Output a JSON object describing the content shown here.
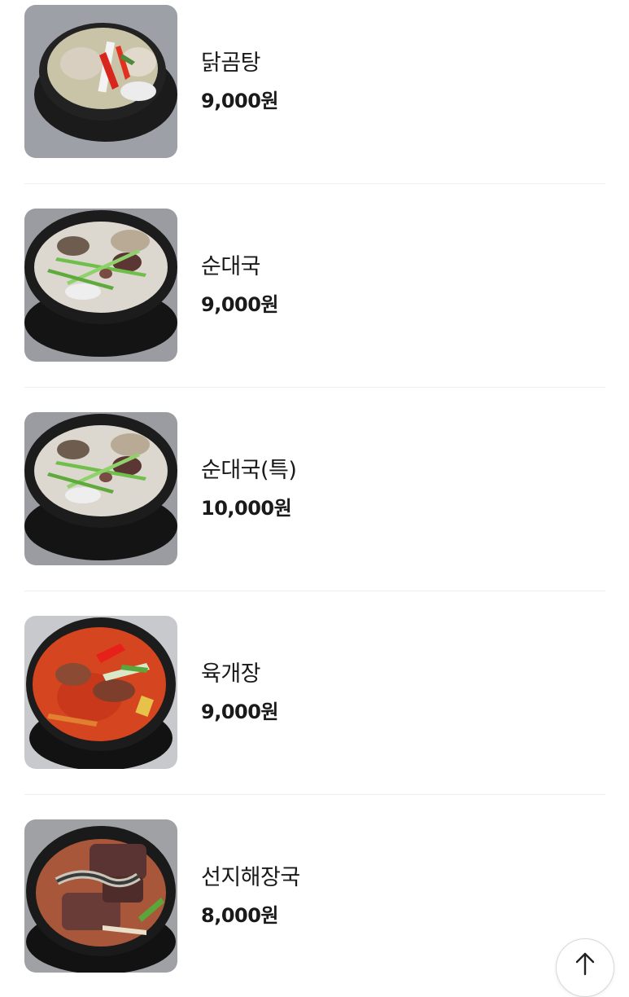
{
  "menu": {
    "items": [
      {
        "name": "닭곰탕",
        "price": "9,000원",
        "image": "dakgomtang-photo"
      },
      {
        "name": "순대국",
        "price": "9,000원",
        "image": "sundaeguk-photo"
      },
      {
        "name": "순대국(특)",
        "price": "10,000원",
        "image": "sundaeguk-special-photo"
      },
      {
        "name": "육개장",
        "price": "9,000원",
        "image": "yukgaejang-photo"
      },
      {
        "name": "선지해장국",
        "price": "8,000원",
        "image": "seonji-haejangguk-photo"
      }
    ]
  },
  "scroll_top_button": {
    "icon": "arrow-up-icon"
  }
}
